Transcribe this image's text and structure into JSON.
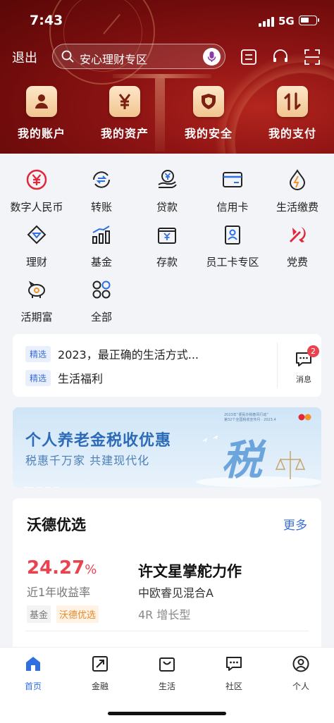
{
  "status_bar": {
    "time": "7:43",
    "network": "5G"
  },
  "header": {
    "logout_label": "退出",
    "search_placeholder": "安心理财专区",
    "quick_actions": [
      {
        "label": "我的账户",
        "icon": "account-icon"
      },
      {
        "label": "我的资产",
        "icon": "yuan-icon"
      },
      {
        "label": "我的安全",
        "icon": "shield-icon"
      },
      {
        "label": "我的支付",
        "icon": "transfer-arrows-icon"
      }
    ],
    "colors": {
      "header_red": "#8f1414",
      "tile_gold": "#f2c48f"
    }
  },
  "services": [
    {
      "label": "数字人民币",
      "icon": "digital-rmb-icon"
    },
    {
      "label": "转账",
      "icon": "transfer-icon"
    },
    {
      "label": "贷款",
      "icon": "loan-icon"
    },
    {
      "label": "信用卡",
      "icon": "credit-card-icon"
    },
    {
      "label": "生活缴费",
      "icon": "utility-icon"
    },
    {
      "label": "理财",
      "icon": "wealth-icon"
    },
    {
      "label": "基金",
      "icon": "fund-chart-icon"
    },
    {
      "label": "存款",
      "icon": "deposit-icon"
    },
    {
      "label": "员工卡专区",
      "icon": "employee-card-icon"
    },
    {
      "label": "党费",
      "icon": "party-emblem-icon"
    },
    {
      "label": "活期富",
      "icon": "piggy-bank-icon"
    },
    {
      "label": "全部",
      "icon": "grid-all-icon"
    }
  ],
  "news": {
    "items": [
      {
        "tag": "精选",
        "text": "2023，最正确的生活方式..."
      },
      {
        "tag": "精选",
        "text": "生活福利"
      }
    ],
    "message_label": "消息",
    "message_count": "2"
  },
  "banner": {
    "title": "个人养老金税收优惠",
    "subtitle": "税惠千万家 共建现代化",
    "big_char": "税",
    "small_text_1": "2023年“便民办税春风行动”",
    "small_text_2": "第32个全国税收宣传月 · 2023.4"
  },
  "card": {
    "title": "沃德优选",
    "more_label": "更多",
    "yield_value": "24.27",
    "yield_unit": "%",
    "yield_label": "近1年收益率",
    "tags": [
      "基金",
      "沃德优选"
    ],
    "product_name": "许文星掌舵力作",
    "fund_name": "中欧睿见混合A",
    "risk_level": "4R 增长型"
  },
  "tabbar": {
    "tabs": [
      {
        "label": "首页",
        "icon": "home-icon",
        "active": true
      },
      {
        "label": "金融",
        "icon": "finance-icon",
        "active": false
      },
      {
        "label": "生活",
        "icon": "life-bag-icon",
        "active": false
      },
      {
        "label": "社区",
        "icon": "community-chat-icon",
        "active": false
      },
      {
        "label": "个人",
        "icon": "profile-icon",
        "active": false
      }
    ],
    "active_color": "#2f6fe0"
  }
}
